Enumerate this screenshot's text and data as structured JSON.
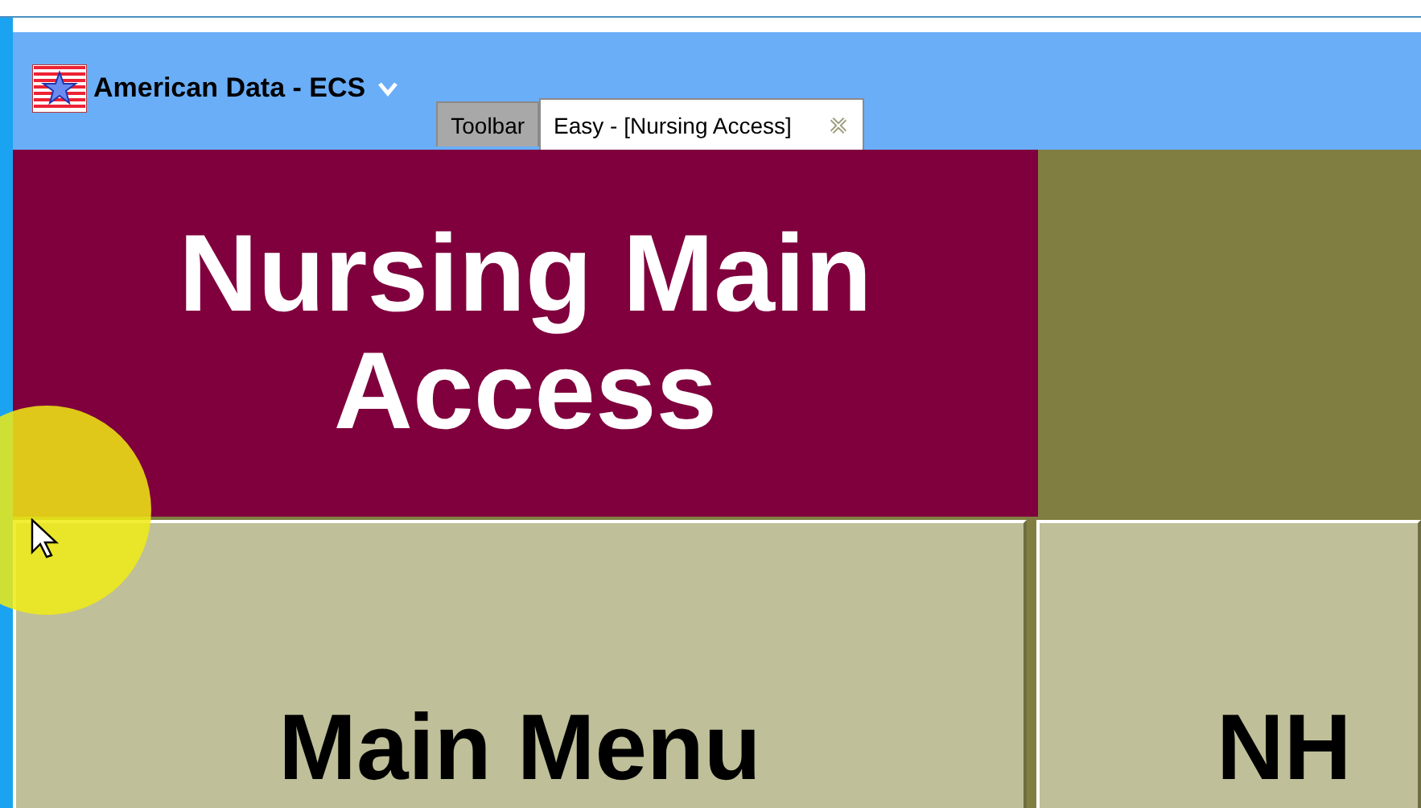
{
  "window": {
    "title": "American Data - ECS"
  },
  "tabs": [
    {
      "label": "Toolbar",
      "selected": false
    },
    {
      "label": "Easy - [Nursing Access]",
      "selected": true
    }
  ],
  "banner": {
    "title": "Nursing Main Access"
  },
  "tiles": [
    {
      "label": "Main Menu"
    },
    {
      "label": "NH"
    }
  ]
}
